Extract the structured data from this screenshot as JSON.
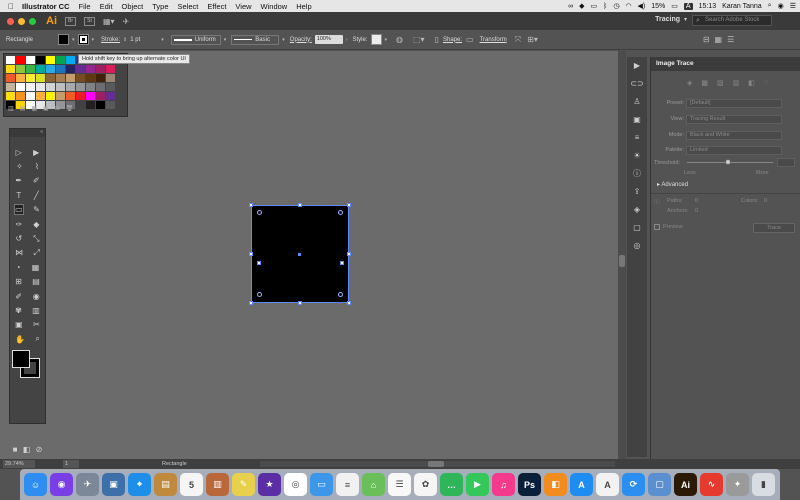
{
  "menubar": {
    "apple_icon": "apple-icon",
    "app_name": "Illustrator CC",
    "items": [
      "File",
      "Edit",
      "Object",
      "Type",
      "Select",
      "Effect",
      "View",
      "Window",
      "Help"
    ],
    "battery": "15%",
    "time": "15:13",
    "user": "Karan Tanna",
    "badge": "A"
  },
  "appbar": {
    "logo": "Ai",
    "br": "Br",
    "st": "St",
    "workspace": "Tracing",
    "search_placeholder": "Search Adobe Stock"
  },
  "control": {
    "object_type": "Rectangle",
    "stroke_label": "Stroke:",
    "stroke_value": "1 pt",
    "profile": "Uniform",
    "brush": "Basic",
    "opacity_label": "Opacity:",
    "opacity_value": "100%",
    "style_label": "Style:",
    "shape_label": "Shape:",
    "transform_label": "Transform"
  },
  "tooltip": "Hold shift key to bring up alternate color UI",
  "swatch_colors": [
    "#ffffff",
    "#ff0000",
    "#ffffff",
    "#000000",
    "#ffff00",
    "#00a651",
    "#00aeef",
    "#2e3192",
    "#ec008c",
    "#f7941d",
    "#ed1c24",
    "#ffde17",
    "#8dc63f",
    "#39b54a",
    "#00a99d",
    "#27aae1",
    "#1c75bc",
    "#262262",
    "#662d91",
    "#92278f",
    "#9e1f63",
    "#da1c5c",
    "#f15a29",
    "#fbb040",
    "#f9ed32",
    "#d7df23",
    "#8c6239",
    "#a67c52",
    "#c69c6d",
    "#754c24",
    "#603913",
    "#42210b",
    "#998675",
    "#c2b59b",
    "#ffffff",
    "#f1f2f2",
    "#e6e7e8",
    "#d1d3d4",
    "#bcbec0",
    "#a7a9ac",
    "#939598",
    "#808285",
    "#6d6e71",
    "#58595b",
    "#ffde17",
    "#f7941d",
    "#ffffff",
    "#fbb040",
    "#fff200",
    "#c69c6d",
    "#f15a29",
    "#ed1c24",
    "#ff00ff",
    "#9e1f63",
    "#662d91",
    "#000000",
    "#ffd400",
    "#ffffff",
    "#e6e7e8",
    "#bcbec0",
    "#939598",
    "#6d6e71",
    "#414042",
    "#231f20",
    "#000000",
    "#58595b"
  ],
  "panel": {
    "title": "Image Trace",
    "rows": [
      {
        "key": "Preset:",
        "value": "[Default]"
      },
      {
        "key": "View:",
        "value": "Tracing Result"
      },
      {
        "key": "Mode:",
        "value": "Black and White"
      },
      {
        "key": "Palette:",
        "value": "Limited"
      }
    ],
    "threshold_label": "Threshold:",
    "threshold_value": 0.5,
    "less": "Less",
    "more": "More",
    "advanced": "Advanced",
    "paths_label": "Paths:",
    "paths_value": "0",
    "colors_label": "Colors:",
    "colors_value": "0",
    "anchors_label": "Anchors:",
    "anchors_value": "0",
    "preview_label": "Preview",
    "trace_button": "Trace"
  },
  "status": {
    "zoom": "29.74%",
    "page": "1",
    "tool": "Rectangle"
  },
  "dock_items": [
    {
      "name": "finder-icon",
      "color": "#2d8df0",
      "glyph": "☺"
    },
    {
      "name": "siri-icon",
      "color": "#7a3ee6",
      "glyph": "◉"
    },
    {
      "name": "launchpad-icon",
      "color": "#7c8797",
      "glyph": "✈"
    },
    {
      "name": "image-capture-icon",
      "color": "#3d6fa8",
      "glyph": "▣"
    },
    {
      "name": "safari-icon",
      "color": "#1e8fe8",
      "glyph": "⌖"
    },
    {
      "name": "notebook-icon",
      "color": "#c08a3e",
      "glyph": "▤"
    },
    {
      "name": "calendar-icon",
      "color": "#f5f5f5",
      "glyph": "5"
    },
    {
      "name": "notes-icon",
      "color": "#b8683a",
      "glyph": "▥"
    },
    {
      "name": "stickies-icon",
      "color": "#e9d04c",
      "glyph": "✎"
    },
    {
      "name": "imovie-icon",
      "color": "#5b2ea6",
      "glyph": "★"
    },
    {
      "name": "chrome-icon",
      "color": "#ffffff",
      "glyph": "◎"
    },
    {
      "name": "preview-icon",
      "color": "#3c97e8",
      "glyph": "▭"
    },
    {
      "name": "textedit-icon",
      "color": "#f1f1f1",
      "glyph": "≡"
    },
    {
      "name": "maps-icon",
      "color": "#6bbf5a",
      "glyph": "⌂"
    },
    {
      "name": "reminders-icon",
      "color": "#f8f8f8",
      "glyph": "☰"
    },
    {
      "name": "photos-icon",
      "color": "#f5f5f5",
      "glyph": "✿"
    },
    {
      "name": "messages-icon",
      "color": "#2fb65a",
      "glyph": "…"
    },
    {
      "name": "facetime-icon",
      "color": "#34c759",
      "glyph": "▶"
    },
    {
      "name": "itunes-icon",
      "color": "#f43a8d",
      "glyph": "♫"
    },
    {
      "name": "photoshop-icon",
      "color": "#0a1f3a",
      "glyph": "Ps"
    },
    {
      "name": "ibooks-icon",
      "color": "#f28c1f",
      "glyph": "◧"
    },
    {
      "name": "appstore-icon",
      "color": "#1e8cf0",
      "glyph": "A"
    },
    {
      "name": "acrobat-icon",
      "color": "#f2f2f2",
      "glyph": "A"
    },
    {
      "name": "sync-icon",
      "color": "#2a8ff0",
      "glyph": "⟳"
    },
    {
      "name": "preview2-icon",
      "color": "#5b8fd0",
      "glyph": "▢"
    },
    {
      "name": "illustrator-icon",
      "color": "#2b1a05",
      "glyph": "Ai"
    },
    {
      "name": "grapher-icon",
      "color": "#e63a2e",
      "glyph": "∿"
    },
    {
      "name": "script-icon",
      "color": "#9a9a9a",
      "glyph": "✦"
    },
    {
      "name": "trash-icon",
      "color": "#d8dde3",
      "glyph": "▮"
    }
  ]
}
